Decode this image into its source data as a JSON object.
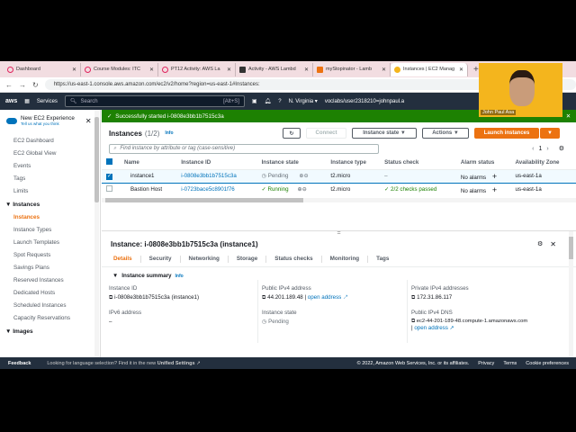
{
  "browser": {
    "tabs": [
      "Dashboard",
      "Course Modules: ITC",
      "PT12 Activity: AWS La",
      "Activity - AWS Lambd",
      "myStopinator - Lamb",
      "Instances | EC2 Manag"
    ],
    "url": "https://us-east-1.console.aws.amazon.com/ec2/v2/home?region=us-east-1#Instances:"
  },
  "awsnav": {
    "logo": "aws",
    "services": "Services",
    "search_placeholder": "Search",
    "shortcut": "[Alt+S]",
    "region": "N. Virginia ▾",
    "account": "voclabs/user2318210=johnpaul.a"
  },
  "sidebar": {
    "experience": "New EC2 Experience",
    "feedback": "Tell us what you think",
    "top": [
      "EC2 Dashboard",
      "EC2 Global View",
      "Events",
      "Tags",
      "Limits"
    ],
    "instances_head": "Instances",
    "instances": [
      "Instances",
      "Instance Types",
      "Launch Templates",
      "Spot Requests",
      "Savings Plans",
      "Reserved Instances",
      "Dedicated Hosts",
      "Scheduled Instances",
      "Capacity Reservations"
    ],
    "images_head": "Images"
  },
  "flash": "Successfully started i-0808e3bb1b7515c3a",
  "list": {
    "title": "Instances",
    "count": "(1/2)",
    "info": "Info",
    "connect": "Connect",
    "state": "Instance state ▼",
    "actions": "Actions ▼",
    "launch": "Launch instances",
    "filter_placeholder": "Find instance by attribute or tag (case-sensitive)",
    "page": "1",
    "columns": [
      "Name",
      "Instance ID",
      "Instance state",
      "Instance type",
      "Status check",
      "Alarm status",
      "Availability Zone"
    ],
    "rows": [
      {
        "name": "instance1",
        "id": "i-0808e3bb1b7515c3a",
        "state": "Pending",
        "type": "t2.micro",
        "check": "–",
        "alarm": "No alarms",
        "az": "us-east-1a"
      },
      {
        "name": "Bastion Host",
        "id": "i-0723bace5c8901f76",
        "state": "Running",
        "type": "t2.micro",
        "check": "2/2 checks passed",
        "alarm": "No alarms",
        "az": "us-east-1a"
      }
    ]
  },
  "detail": {
    "title": "Instance: i-0808e3bb1b7515c3a (instance1)",
    "tabs": [
      "Details",
      "Security",
      "Networking",
      "Storage",
      "Status checks",
      "Monitoring",
      "Tags"
    ],
    "summary": "Instance summary",
    "info": "Info",
    "instance_id_label": "Instance ID",
    "instance_id": "i-0808e3bb1b7515c3a (instance1)",
    "ipv6_label": "IPv6 address",
    "ipv6": "–",
    "public_ip_label": "Public IPv4 address",
    "public_ip": "44.201.189.48",
    "open": "open address",
    "state_label": "Instance state",
    "state": "Pending",
    "private_ip_label": "Private IPv4 addresses",
    "private_ip": "172.31.86.117",
    "dns_label": "Public IPv4 DNS",
    "dns": "ec2-44-201-189-48.compute-1.amazonaws.com"
  },
  "footer": {
    "feedback": "Feedback",
    "lang": "Looking for language selection? Find it in the new",
    "unified": "Unified Settings",
    "copy": "© 2022, Amazon Web Services, Inc. or its affiliates.",
    "privacy": "Privacy",
    "terms": "Terms",
    "cookies": "Cookie preferences"
  },
  "webcam": {
    "name": "John Paul Asa"
  }
}
